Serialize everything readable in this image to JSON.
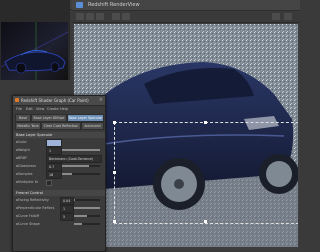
{
  "app": {
    "render_title": "Redshift RenderView"
  },
  "panel": {
    "title": "Redshift Shader Graph (Car Paint)",
    "menu": [
      "File",
      "Edit",
      "View",
      "Create",
      "Help"
    ],
    "tabs": [
      "Base",
      "Base Layer Diffuse",
      "Base Layer Specular",
      "Metallic Tone",
      "Clear Coat Reflection",
      "Advanced"
    ],
    "sections": [
      {
        "header": "Base Layer Specular",
        "rows": [
          {
            "label": "Color",
            "type": "color",
            "value": ""
          },
          {
            "label": "Weight",
            "type": "slider",
            "value": "1",
            "fill": 1.0
          },
          {
            "label": "BRDF",
            "type": "dropdown",
            "value": "Beckmann (Cook-Torrance)"
          },
          {
            "label": "Glossiness",
            "type": "slider",
            "value": "0.7",
            "fill": 0.7
          },
          {
            "label": "Samples",
            "type": "slider",
            "value": "16",
            "fill": 0.25
          },
          {
            "label": "Multiplier Kr",
            "type": "check",
            "value": ""
          }
        ]
      },
      {
        "header": "Fresnel Control",
        "rows": [
          {
            "label": "Facing Reflectivity",
            "type": "slider",
            "value": "0.04",
            "fill": 0.04
          },
          {
            "label": "Perpendicular Reflect.",
            "type": "slider",
            "value": "1",
            "fill": 1.0
          },
          {
            "label": "Curve Falloff",
            "type": "slider",
            "value": "5",
            "fill": 0.5
          },
          {
            "label": "Curve Shape",
            "type": "slider",
            "value": "",
            "fill": 0.3
          }
        ]
      }
    ]
  },
  "colors": {
    "accent": "#6b8fb6",
    "car_body": "#1f2a4f",
    "active_tab": "#6b8fb6"
  },
  "icons": [
    "window-icon",
    "close-icon",
    "render-icon",
    "crop-handle-icon"
  ]
}
